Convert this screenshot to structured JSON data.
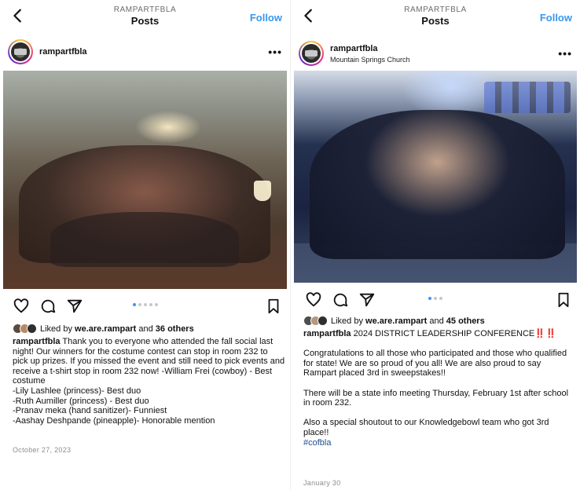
{
  "left": {
    "header": {
      "username": "RAMPARTFBLA",
      "title": "Posts",
      "follow": "Follow"
    },
    "post": {
      "username": "rampartfbla",
      "more": "•••",
      "carousel": {
        "count": 5,
        "active": 0
      },
      "likes": {
        "prefix": "Liked by ",
        "user": "we.are.rampart",
        "and": " and ",
        "count": "36 others"
      },
      "caption": {
        "username": "rampartfbla",
        "lines": [
          "Thank you to everyone who attended the fall social last night! Our winners for the costume contest can stop in room 232 to pick up prizes. If you missed the event and still need to pick events and receive a t-shirt stop in room 232 now! -William Frei (cowboy) - Best costume",
          "-Lily Lashlee (princess)- Best duo",
          "-Ruth Aumiller (princess) - Best duo",
          "-Pranav meka (hand sanitizer)- Funniest",
          "-Aashay Deshpande (pineapple)- Honorable mention"
        ]
      },
      "date": "October 27, 2023"
    }
  },
  "right": {
    "header": {
      "username": "RAMPARTFBLA",
      "title": "Posts",
      "follow": "Follow"
    },
    "post": {
      "username": "rampartfbla",
      "location": "Mountain Springs Church",
      "more": "•••",
      "carousel": {
        "count": 3,
        "active": 0
      },
      "likes": {
        "prefix": "Liked by ",
        "user": "we.are.rampart",
        "and": " and ",
        "count": "45 others"
      },
      "caption": {
        "username": "rampartfbla",
        "headline": "2024 DISTRICT LEADERSHIP CONFERENCE",
        "emoji": "‼️‼️",
        "para1": "Congratulations to all those who participated and those who qualified for state! We are so proud of you all! We are also proud to say Rampart placed 3rd in sweepstakes!!",
        "para2": "There will be a state info meeting Thursday, February 1st after school in room 232.",
        "para3": "Also a special shoutout to our Knowledgebowl team who got 3rd place!!",
        "hashtag": "#cofbla"
      },
      "date": "January 30"
    }
  },
  "colors": {
    "accent": "#3897f0",
    "muted": "#8e8e8e",
    "alert": "#e0243a"
  },
  "icons": [
    "back-chevron-icon",
    "more-icon",
    "heart-icon",
    "comment-icon",
    "share-icon",
    "bookmark-icon"
  ]
}
